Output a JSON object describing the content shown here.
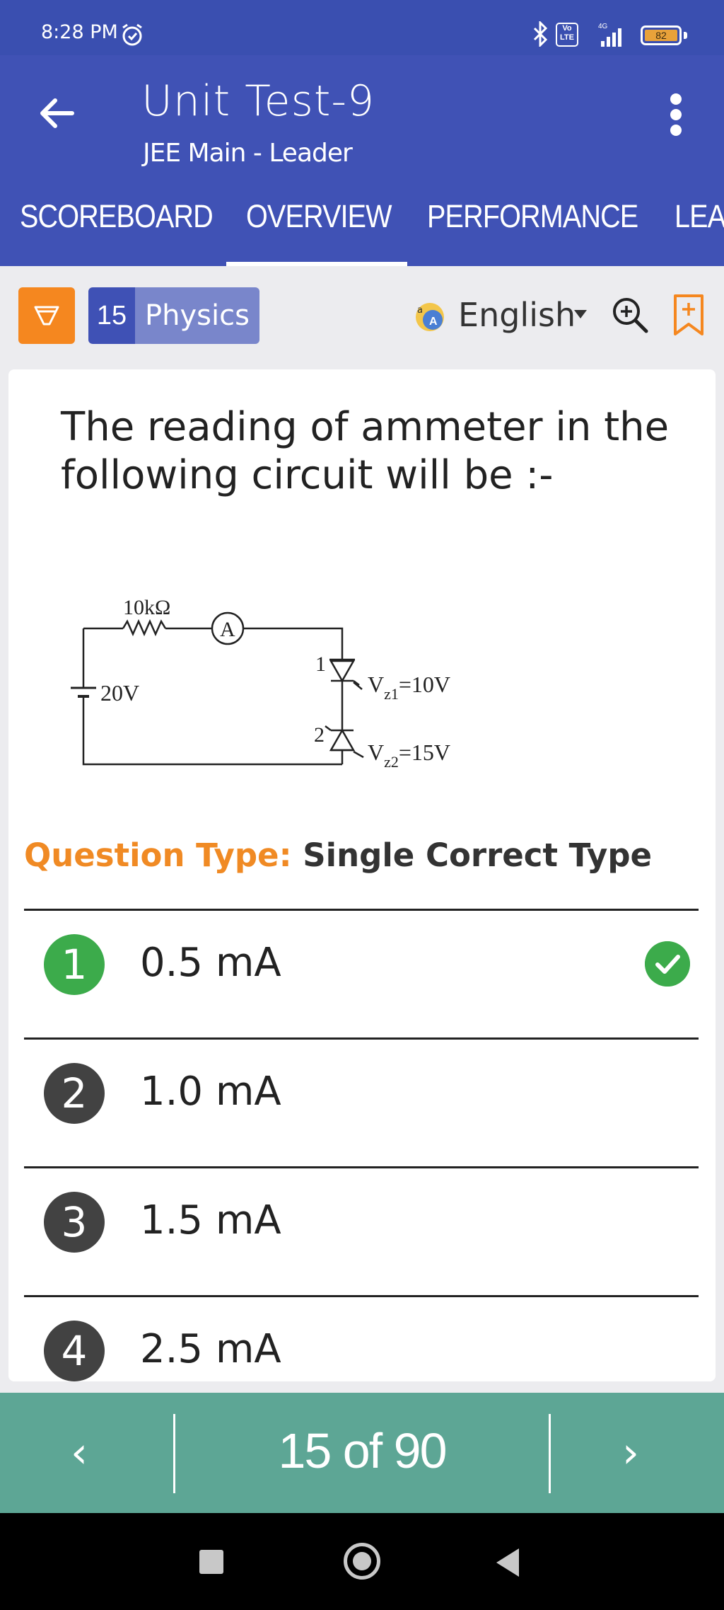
{
  "status_bar": {
    "time": "8:28 PM",
    "network": "4G",
    "volte": "Vo LTE",
    "battery": "82"
  },
  "app_bar": {
    "title": "Unit Test-9",
    "subtitle": "JEE Main - Leader"
  },
  "tabs": [
    {
      "label": "SCOREBOARD",
      "active": false
    },
    {
      "label": "OVERVIEW",
      "active": true
    },
    {
      "label": "PERFORMANCE",
      "active": false
    },
    {
      "label": "LEA",
      "active": false
    }
  ],
  "filter_bar": {
    "question_number": "15",
    "subject": "Physics",
    "language": "English"
  },
  "question": {
    "text": "The reading of ammeter in the following circuit will be :-",
    "type_label": "Question Type:",
    "type_value": "Single Correct Type",
    "circuit": {
      "resistor": "10kΩ",
      "ammeter": "A",
      "source": "20V",
      "diode1_index": "1",
      "diode2_index": "2",
      "vz1_label": "V",
      "vz1_sub": "z1",
      "vz1_value": "=10V",
      "vz2_label": "V",
      "vz2_sub": "z2",
      "vz2_value": "=15V"
    }
  },
  "options": [
    {
      "number": "1",
      "text": "0.5 mA",
      "correct": true
    },
    {
      "number": "2",
      "text": "1.0 mA",
      "correct": false
    },
    {
      "number": "3",
      "text": "1.5 mA",
      "correct": false
    },
    {
      "number": "4",
      "text": "2.5 mA",
      "correct": false
    }
  ],
  "bottom_nav": {
    "prev": "‹",
    "next": "›",
    "counter": "15 of 90"
  },
  "colors": {
    "app_bar": "#4052b5",
    "filter_orange": "#f5871f",
    "subject_num_bg": "#3f51b5",
    "subject_bg": "#7986cb",
    "correct_green": "#3cab4b",
    "question_type_label": "#f08a24",
    "bottom_nav": "#5da695"
  }
}
